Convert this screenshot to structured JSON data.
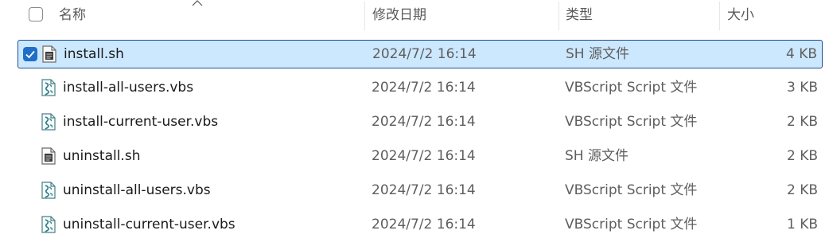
{
  "columns": {
    "name": "名称",
    "modified": "修改日期",
    "type": "类型",
    "size": "大小"
  },
  "files": [
    {
      "name": "install.sh",
      "modified": "2024/7/2 16:14",
      "type": "SH 源文件",
      "size": "4 KB",
      "icon": "shell-script-file-icon",
      "selected": true
    },
    {
      "name": "install-all-users.vbs",
      "modified": "2024/7/2 16:14",
      "type": "VBScript Script 文件",
      "size": "3 KB",
      "icon": "vbscript-file-icon",
      "selected": false
    },
    {
      "name": "install-current-user.vbs",
      "modified": "2024/7/2 16:14",
      "type": "VBScript Script 文件",
      "size": "2 KB",
      "icon": "vbscript-file-icon",
      "selected": false
    },
    {
      "name": "uninstall.sh",
      "modified": "2024/7/2 16:14",
      "type": "SH 源文件",
      "size": "2 KB",
      "icon": "shell-script-file-icon",
      "selected": false
    },
    {
      "name": "uninstall-all-users.vbs",
      "modified": "2024/7/2 16:14",
      "type": "VBScript Script 文件",
      "size": "2 KB",
      "icon": "vbscript-file-icon",
      "selected": false
    },
    {
      "name": "uninstall-current-user.vbs",
      "modified": "2024/7/2 16:14",
      "type": "VBScript Script 文件",
      "size": "1 KB",
      "icon": "vbscript-file-icon",
      "selected": false
    }
  ],
  "colors": {
    "selection_background": "#cce8ff",
    "selection_border": "#1f4f8f",
    "checkbox_accent": "#1f6fc7"
  }
}
